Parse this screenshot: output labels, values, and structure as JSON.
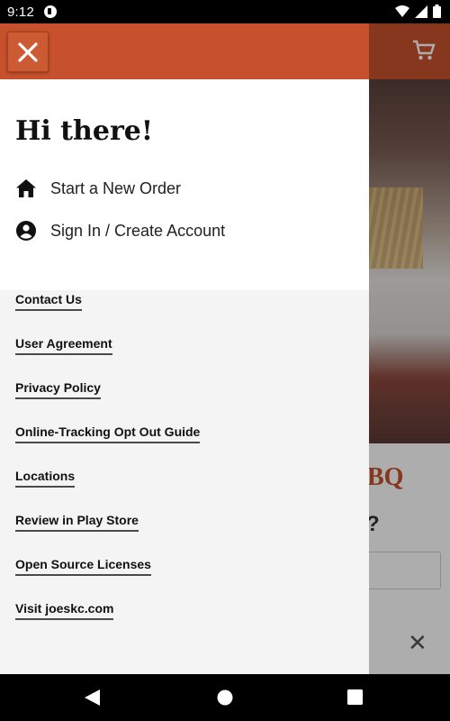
{
  "status_bar": {
    "time": "9:12"
  },
  "background": {
    "partial_title": "BQ",
    "partial_question": "?",
    "close_symbol": "✕"
  },
  "drawer": {
    "greeting": "Hi there!",
    "menu": [
      {
        "label": "Start a New Order",
        "icon": "home-icon"
      },
      {
        "label": "Sign In / Create Account",
        "icon": "account-circle-icon"
      }
    ],
    "links": [
      "Contact Us",
      "User Agreement",
      "Privacy Policy",
      "Online-Tracking Opt Out Guide",
      "Locations",
      "Review in Play Store",
      "Open Source Licenses",
      "Visit joeskc.com"
    ]
  },
  "colors": {
    "brand": "#c6512c",
    "drawer_bg": "#f4f4f4"
  }
}
